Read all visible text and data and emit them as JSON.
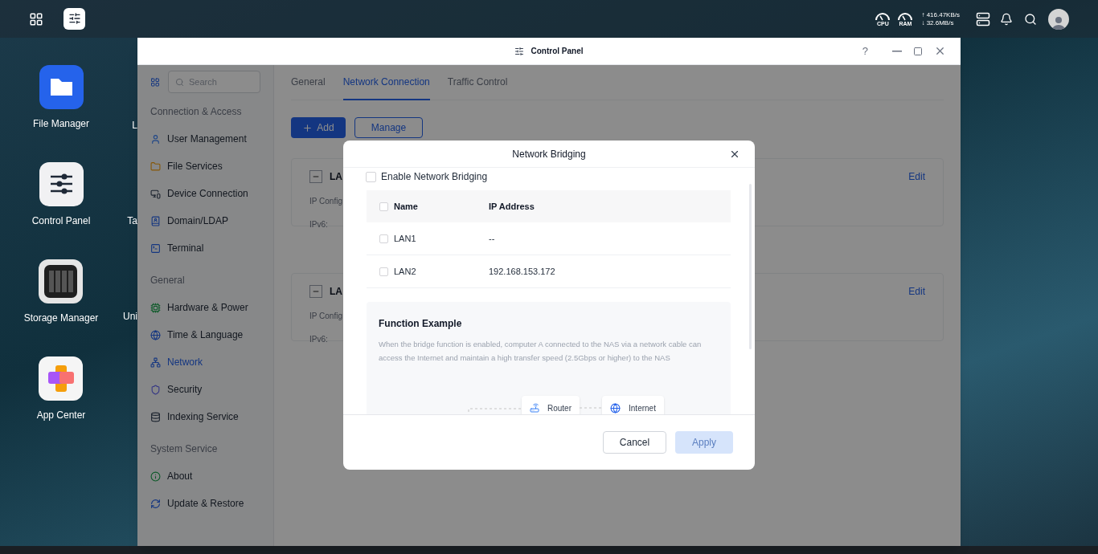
{
  "topbar": {
    "cpu_label": "CPU",
    "ram_label": "RAM",
    "upload": "↑ 416.47KB/s",
    "download": "↓ 32.6MB/s"
  },
  "desktop_icons": [
    {
      "label": "File Manager",
      "kind": "folder"
    },
    {
      "label": "Control Panel",
      "kind": "sliders"
    },
    {
      "label": "Storage Manager",
      "kind": "storage"
    },
    {
      "label": "App Center",
      "kind": "apps"
    }
  ],
  "desktop_icons_partial": [
    "L",
    "Ta",
    "Uni"
  ],
  "window": {
    "title": "Control Panel",
    "help": "?"
  },
  "sidebar": {
    "search": {
      "placeholder": "Search"
    },
    "sections": [
      {
        "title": "Connection & Access",
        "items": [
          {
            "label": "User Management",
            "kind": "user",
            "selected": false
          },
          {
            "label": "File Services",
            "kind": "folder",
            "selected": false
          },
          {
            "label": "Device Connection",
            "kind": "device",
            "selected": false
          },
          {
            "label": "Domain/LDAP",
            "kind": "domain",
            "selected": false
          },
          {
            "label": "Terminal",
            "kind": "terminal",
            "selected": false
          }
        ]
      },
      {
        "title": "General",
        "items": [
          {
            "label": "Hardware & Power",
            "kind": "hardware",
            "selected": false
          },
          {
            "label": "Time & Language",
            "kind": "globe",
            "selected": false
          },
          {
            "label": "Network",
            "kind": "network",
            "selected": true
          },
          {
            "label": "Security",
            "kind": "shield",
            "selected": false
          },
          {
            "label": "Indexing Service",
            "kind": "index",
            "selected": false
          }
        ]
      },
      {
        "title": "System Service",
        "items": [
          {
            "label": "About",
            "kind": "info",
            "selected": false
          },
          {
            "label": "Update & Restore",
            "kind": "update",
            "selected": false
          }
        ]
      }
    ]
  },
  "tabs": [
    {
      "label": "General",
      "selected": false
    },
    {
      "label": "Network Connection",
      "selected": true
    },
    {
      "label": "Traffic Control",
      "selected": false
    }
  ],
  "actions": {
    "add": "Add",
    "manage": "Manage"
  },
  "cards": [
    {
      "title": "LA",
      "rows": [
        "IP Config",
        "IPv6:"
      ],
      "edit": "Edit"
    },
    {
      "title": "LA",
      "rows": [
        "IP Config",
        "IPv6:"
      ],
      "edit": "Edit"
    }
  ],
  "dialog": {
    "title": "Network Bridging",
    "enable": {
      "label": "Enable Network Bridging",
      "checked": false
    },
    "table": {
      "columns": [
        "Name",
        "IP Address"
      ],
      "all_checked": false,
      "rows": [
        {
          "name": "LAN1",
          "ip": "--",
          "checked": false
        },
        {
          "name": "LAN2",
          "ip": "192.168.153.172",
          "checked": false
        }
      ]
    },
    "example": {
      "title": "Function Example",
      "text": "When the bridge function is enabled, computer A connected to the NAS via a network cable can access the Internet and maintain a high transfer speed (2.5Gbps or higher) to the NAS",
      "nodes": [
        {
          "label": "Router",
          "kind": "router"
        },
        {
          "label": "Internet",
          "kind": "internet"
        }
      ]
    },
    "cancel": "Cancel",
    "apply": {
      "label": "Apply",
      "disabled": true
    }
  }
}
